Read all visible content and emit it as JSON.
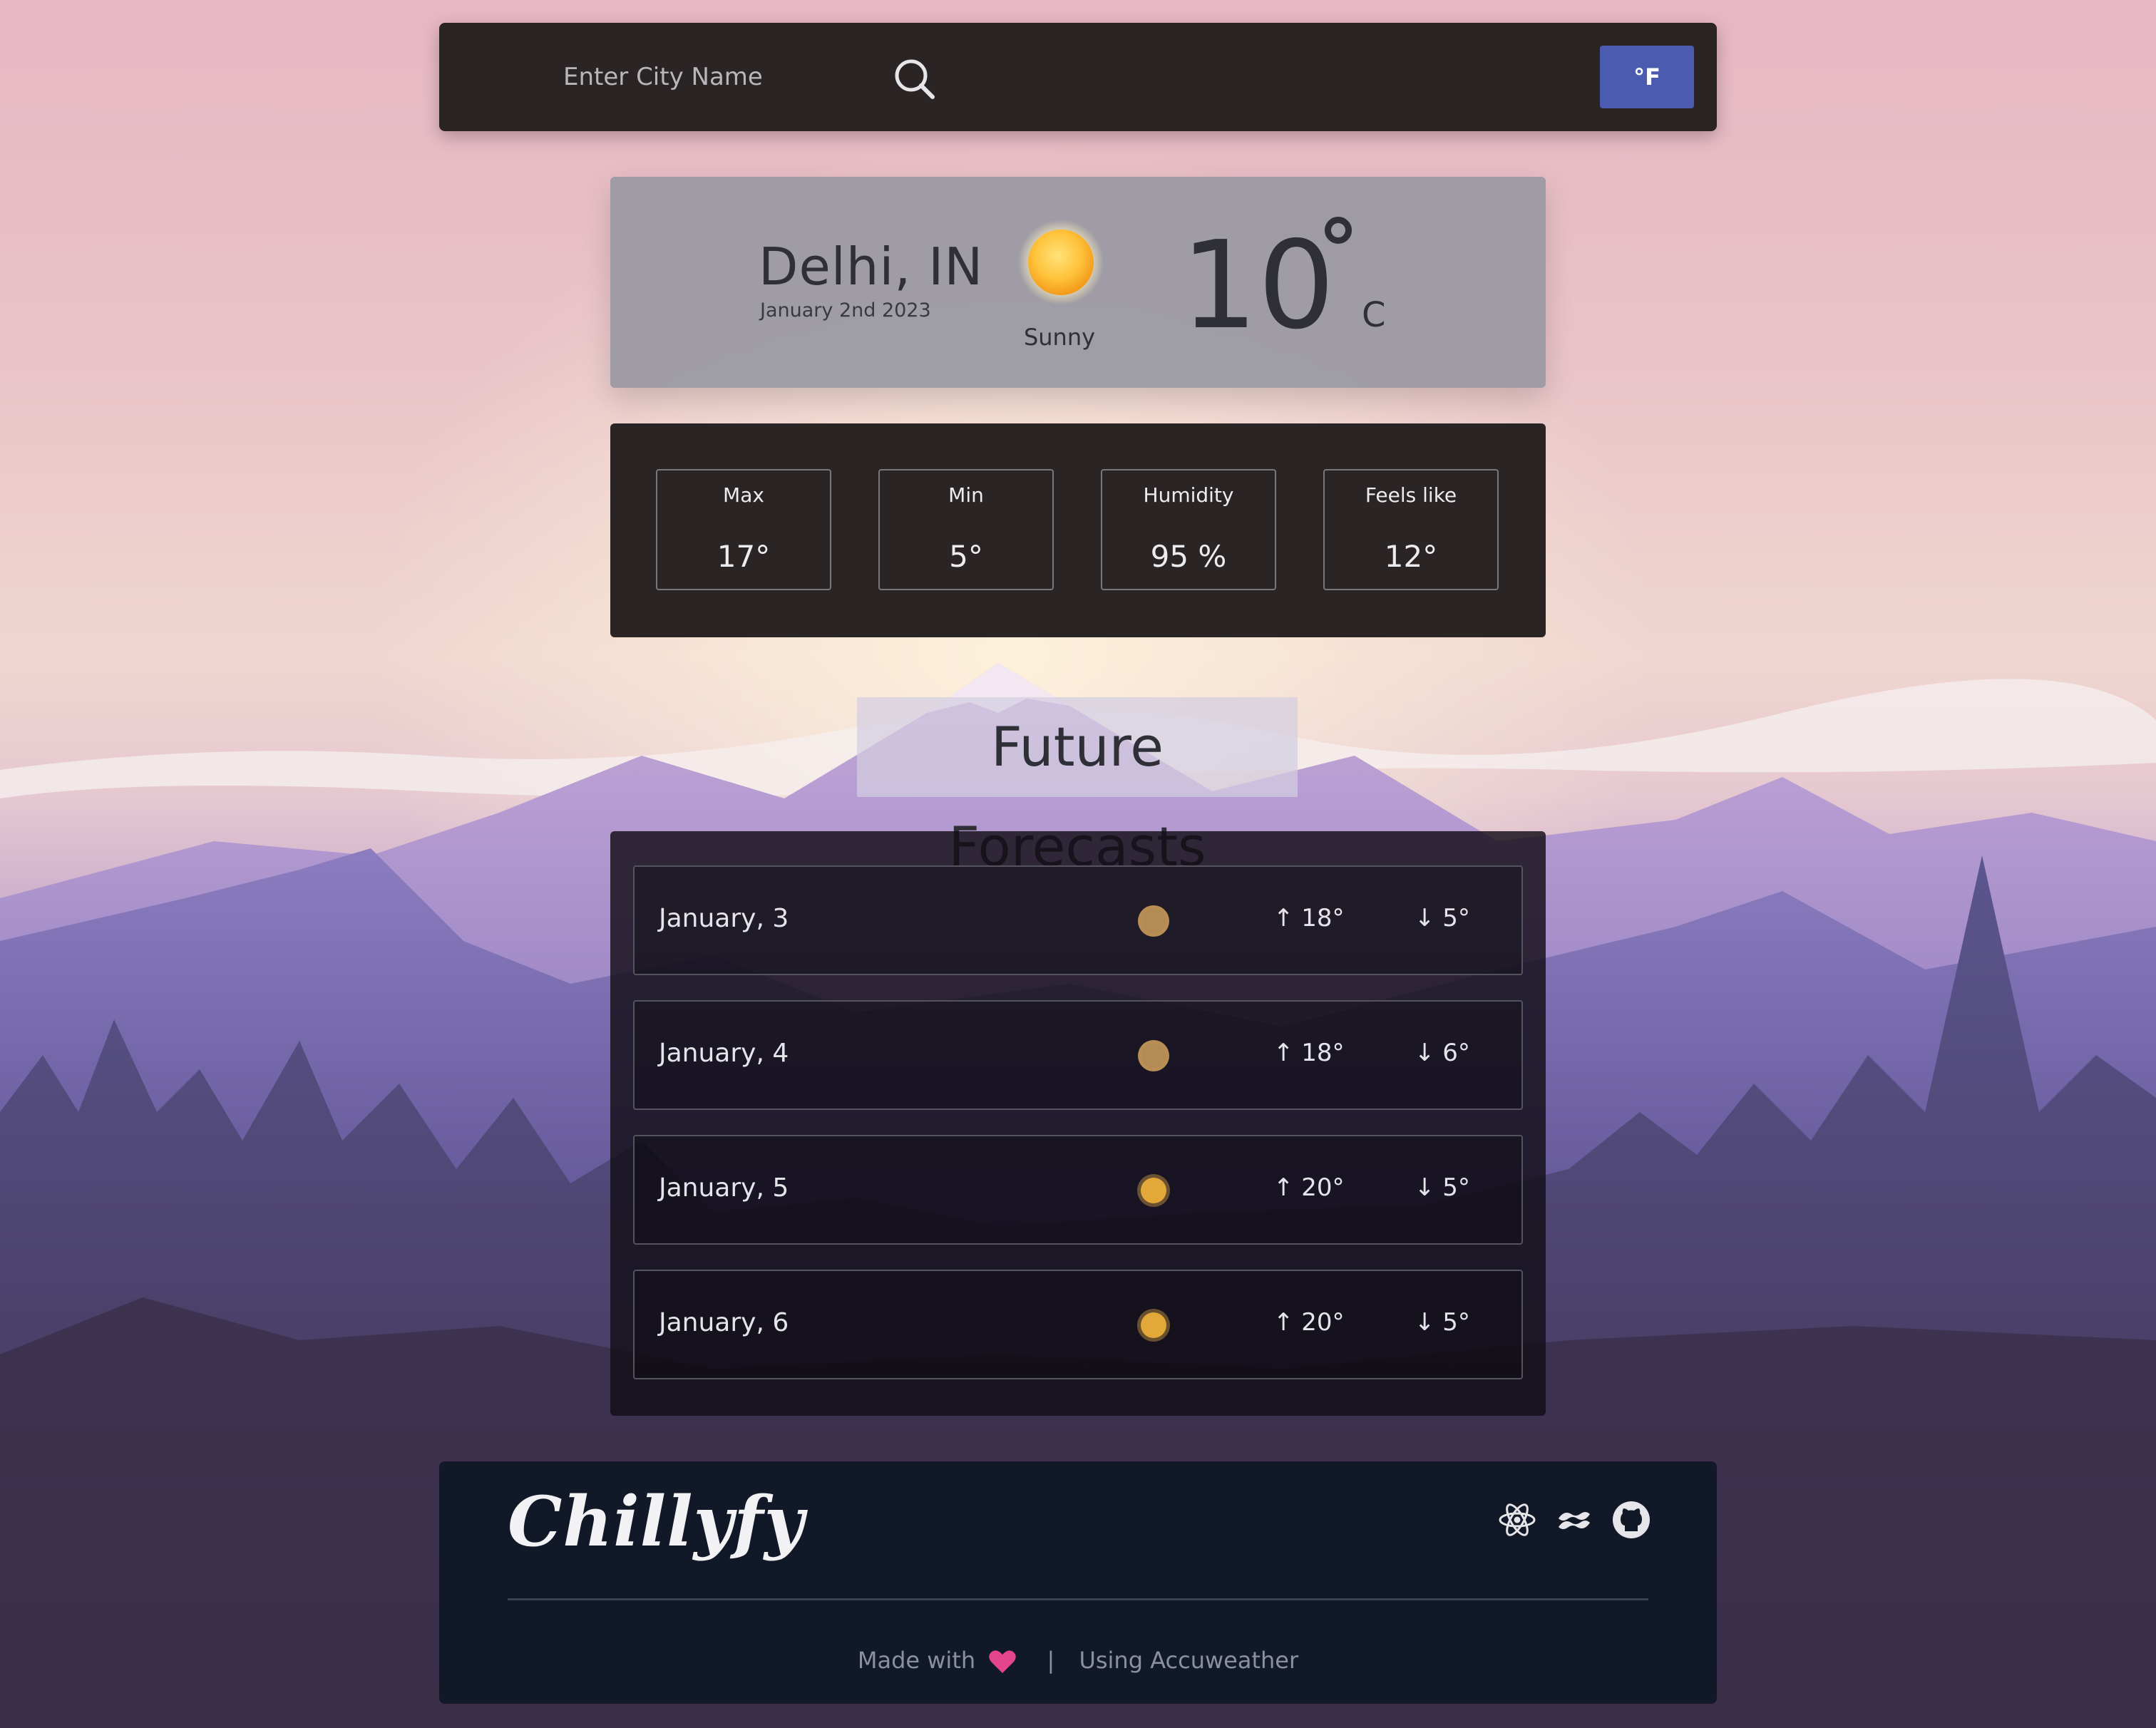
{
  "search": {
    "placeholder": "Enter City Name",
    "unit_toggle_label": "°F"
  },
  "current": {
    "city": "Delhi, IN",
    "date": "January 2nd 2023",
    "condition": "Sunny",
    "temperature": "10",
    "unit": "C",
    "icon": "sun-icon"
  },
  "stats": [
    {
      "label": "Max",
      "value": "17°"
    },
    {
      "label": "Min",
      "value": "5°"
    },
    {
      "label": "Humidity",
      "value": "95 %"
    },
    {
      "label": "Feels like",
      "value": "12°"
    }
  ],
  "forecast": {
    "heading": "Future Forecasts",
    "days": [
      {
        "date": "January, 3",
        "high": "↑ 18°",
        "low": "↓ 5°",
        "icon": "moon-icon"
      },
      {
        "date": "January, 4",
        "high": "↑ 18°",
        "low": "↓ 6°",
        "icon": "moon-icon"
      },
      {
        "date": "January, 5",
        "high": "↑ 20°",
        "low": "↓ 5°",
        "icon": "sun-icon"
      },
      {
        "date": "January, 6",
        "high": "↑ 20°",
        "low": "↓ 5°",
        "icon": "sun-icon"
      }
    ]
  },
  "footer": {
    "brand": "Chillyfy",
    "made_with": "Made with",
    "separator": "|",
    "using": "Using Accuweather",
    "icons": [
      "react-icon",
      "tailwind-icon",
      "github-icon"
    ]
  },
  "colors": {
    "accent": "#4b5bb0",
    "panel_dark": "#2b2424",
    "footer_bg": "#111827",
    "heart": "#e5458f"
  }
}
